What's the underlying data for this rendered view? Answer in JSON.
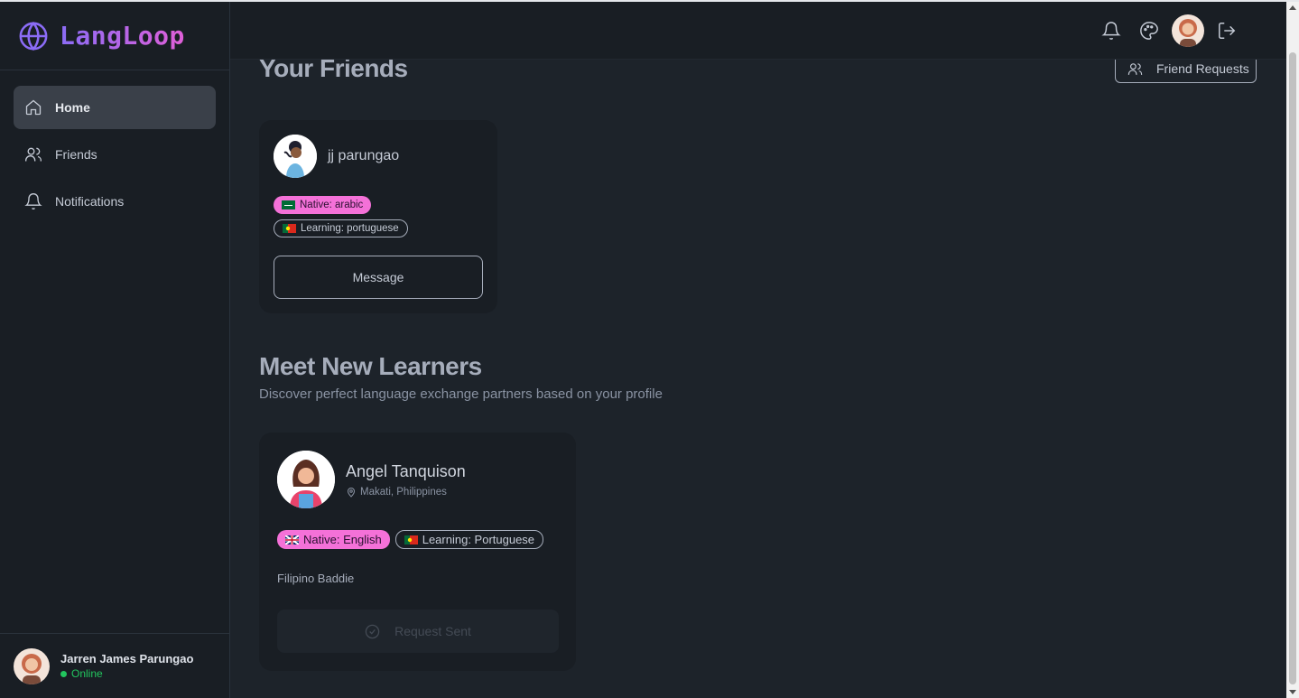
{
  "app": {
    "name": "LangLoop"
  },
  "sidebar": {
    "items": [
      {
        "label": "Home",
        "icon": "home-icon",
        "active": true
      },
      {
        "label": "Friends",
        "icon": "users-icon",
        "active": false
      },
      {
        "label": "Notifications",
        "icon": "bell-icon",
        "active": false
      }
    ],
    "user": {
      "name": "Jarren James Parungao",
      "status": "Online"
    }
  },
  "header": {
    "icons": [
      "bell-icon",
      "palette-icon",
      "avatar",
      "logout-icon"
    ]
  },
  "friends_section": {
    "title": "Your Friends",
    "requests_button": "Friend Requests",
    "friends": [
      {
        "name": "jj parungao",
        "native": "Native: arabic",
        "learning": "Learning: portuguese",
        "message_button": "Message"
      }
    ]
  },
  "learners_section": {
    "title": "Meet New Learners",
    "subtitle": "Discover perfect language exchange partners based on your profile",
    "learners": [
      {
        "name": "Angel Tanquison",
        "location": "Makati, Philippines",
        "native": "Native: English",
        "learning": "Learning: Portuguese",
        "bio": "Filipino Baddie",
        "button": "Request Sent"
      }
    ]
  },
  "colors": {
    "accent": "#f471d8",
    "brand_start": "#8b6cf6",
    "brand_end": "#e05fd8",
    "online": "#22c55e"
  }
}
